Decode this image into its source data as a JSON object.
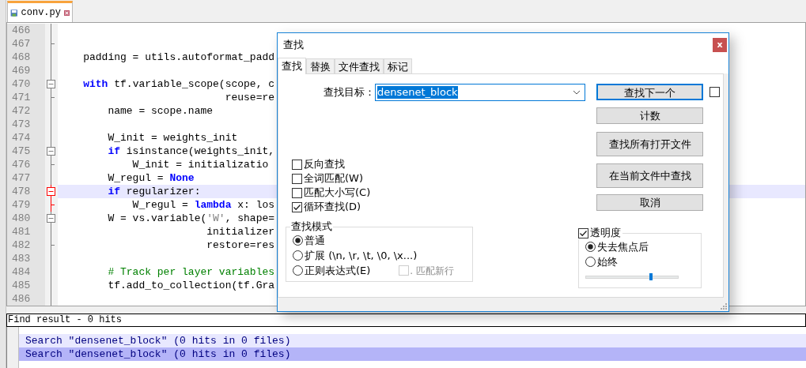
{
  "editor_tab": {
    "title": "conv.py"
  },
  "code_lines": [
    {
      "number": "466",
      "fold_start": false,
      "fold_end": false,
      "current": false,
      "highlighted": false
    },
    {
      "number": "467",
      "fold_start": false,
      "fold_end": true,
      "current": false,
      "highlighted": false
    },
    {
      "number": "468",
      "fold_start": false,
      "fold_end": false,
      "current": false,
      "highlighted": false,
      "segments": [
        {
          "kind": "plain",
          "text": "    padding = utils.autoformat_padd"
        }
      ]
    },
    {
      "number": "469",
      "fold_start": false,
      "fold_end": false,
      "current": false,
      "highlighted": false
    },
    {
      "number": "470",
      "fold_start": true,
      "fold_end": false,
      "current": false,
      "highlighted": false,
      "segments": [
        {
          "kind": "keyword",
          "text": "    with"
        },
        {
          "kind": "plain",
          "text": " tf.variable_scope(scope, c"
        }
      ]
    },
    {
      "number": "471",
      "fold_start": false,
      "fold_end": true,
      "current": false,
      "highlighted": false,
      "segments": [
        {
          "kind": "plain",
          "text": "                           reuse=re"
        }
      ]
    },
    {
      "number": "472",
      "fold_start": false,
      "fold_end": false,
      "current": false,
      "highlighted": false,
      "segments": [
        {
          "kind": "plain",
          "text": "        name = scope.name"
        }
      ]
    },
    {
      "number": "473",
      "fold_start": false,
      "fold_end": false,
      "current": false,
      "highlighted": false
    },
    {
      "number": "474",
      "fold_start": false,
      "fold_end": false,
      "current": false,
      "highlighted": false,
      "segments": [
        {
          "kind": "plain",
          "text": "        W_init = weights_init"
        }
      ]
    },
    {
      "number": "475",
      "fold_start": true,
      "fold_end": false,
      "current": false,
      "highlighted": false,
      "segments": [
        {
          "kind": "keyword",
          "text": "        if"
        },
        {
          "kind": "plain",
          "text": " isinstance(weights_init,"
        }
      ]
    },
    {
      "number": "476",
      "fold_start": false,
      "fold_end": true,
      "current": false,
      "highlighted": false,
      "segments": [
        {
          "kind": "plain",
          "text": "            W_init = initializatio"
        }
      ]
    },
    {
      "number": "477",
      "fold_start": false,
      "fold_end": false,
      "current": false,
      "highlighted": false,
      "segments": [
        {
          "kind": "plain",
          "text": "        W_regul = "
        },
        {
          "kind": "keyword",
          "text": "None"
        }
      ]
    },
    {
      "number": "478",
      "fold_start": true,
      "fold_end": false,
      "current": true,
      "highlighted": true,
      "segments": [
        {
          "kind": "keyword",
          "text": "        if"
        },
        {
          "kind": "plain",
          "text": " regularizer:"
        }
      ]
    },
    {
      "number": "479",
      "fold_start": false,
      "fold_end": true,
      "current": true,
      "highlighted": false,
      "segments": [
        {
          "kind": "plain",
          "text": "            W_regul = "
        },
        {
          "kind": "keyword",
          "text": "lambda"
        },
        {
          "kind": "plain",
          "text": " x: los"
        }
      ]
    },
    {
      "number": "480",
      "fold_start": true,
      "fold_end": false,
      "current": false,
      "highlighted": false,
      "segments": [
        {
          "kind": "plain",
          "text": "        W = vs.variable("
        },
        {
          "kind": "string",
          "text": "'W'"
        },
        {
          "kind": "plain",
          "text": ", shape="
        }
      ]
    },
    {
      "number": "481",
      "fold_start": false,
      "fold_end": false,
      "current": false,
      "highlighted": false,
      "segments": [
        {
          "kind": "plain",
          "text": "                        initializer"
        }
      ]
    },
    {
      "number": "482",
      "fold_start": false,
      "fold_end": true,
      "current": false,
      "highlighted": false,
      "segments": [
        {
          "kind": "plain",
          "text": "                        restore=res"
        }
      ]
    },
    {
      "number": "483",
      "fold_start": false,
      "fold_end": false,
      "current": false,
      "highlighted": false
    },
    {
      "number": "484",
      "fold_start": false,
      "fold_end": false,
      "current": false,
      "highlighted": false,
      "segments": [
        {
          "kind": "comment",
          "text": "        # Track per layer variables"
        }
      ]
    },
    {
      "number": "485",
      "fold_start": false,
      "fold_end": false,
      "current": false,
      "highlighted": false,
      "segments": [
        {
          "kind": "plain",
          "text": "        tf.add_to_collection(tf.Gra"
        }
      ]
    },
    {
      "number": "486",
      "fold_start": false,
      "fold_end": false,
      "current": false,
      "highlighted": false
    }
  ],
  "find_dialog": {
    "title": "查找",
    "close": "x",
    "tabs": [
      {
        "label": "查找",
        "selected": true
      },
      {
        "label": "替换",
        "selected": false
      },
      {
        "label": "文件查找",
        "selected": false
      },
      {
        "label": "标记",
        "selected": false
      }
    ],
    "search": {
      "label": "查找目标：",
      "value": "densenet_block"
    },
    "buttons": [
      {
        "label": "查找下一个",
        "default": true
      },
      {
        "label": "计数",
        "default": false
      },
      {
        "label": "查找所有打开文件",
        "default": false
      },
      {
        "label": "在当前文件中查找",
        "default": false
      },
      {
        "label": "取消",
        "default": false
      }
    ],
    "side_checkbox": {
      "checked": false
    },
    "options": [
      {
        "label": "反向查找",
        "checked": false
      },
      {
        "label": "全词匹配(W)",
        "checked": false
      },
      {
        "label": "匹配大小写(C)",
        "checked": false
      },
      {
        "label": "循环查找(D)",
        "checked": true
      }
    ],
    "mode_group": {
      "title": "查找模式",
      "modes": [
        {
          "label": "普通",
          "selected": true
        },
        {
          "label": "扩展 (\\n, \\r, \\t, \\0, \\x...)",
          "selected": false
        },
        {
          "label": "正则表达式(E)",
          "selected": false
        }
      ],
      "dot_newline": {
        "label": ". 匹配新行",
        "checked": false,
        "disabled": true
      }
    },
    "transparency": {
      "label": "透明度",
      "checked": true,
      "modes": [
        {
          "label": "失去焦点后",
          "selected": true
        },
        {
          "label": "始终",
          "selected": false
        }
      ],
      "level": 0.7
    }
  },
  "find_results": {
    "title": "Find result - 0 hits",
    "rows": [
      {
        "text": "Search \"densenet_block\" (0 hits in 0 files)",
        "selected": false
      },
      {
        "text": "Search \"densenet_block\" (0 hits in 0 files)",
        "selected": true
      }
    ]
  }
}
